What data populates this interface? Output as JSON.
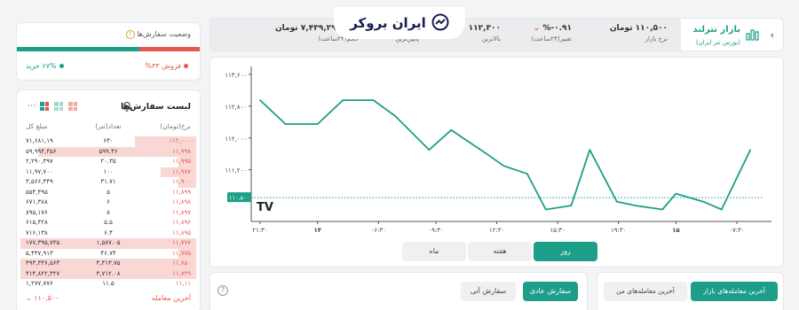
{
  "status": {
    "title": "وضعیت سفارش‌ها",
    "info_icon": "info-circle-icon",
    "sell_label": "فروش ۳۳%",
    "buy_label": "۶۷% خرید",
    "sell_percent": 33,
    "buy_percent": 67
  },
  "orders": {
    "title": "لیست سفارش‌ها",
    "bell_icon": "bell-plus-icon",
    "columns": [
      "نرخ(تومان)",
      "تعداد(تتر)",
      "مبلغ کل"
    ],
    "rows": [
      {
        "price": "۱۱۲,۰۰۰",
        "qty": "۶۴۰",
        "amount": "۷۱,۶۸۱,۱۹",
        "fill": 0.35
      },
      {
        "price": "۱۱,۹۹۸",
        "qty": "۵۹۹.۴۶",
        "amount": "۵۹,۹۹۴,۴۵۶",
        "fill": 0.9
      },
      {
        "price": "۱۱,۹۹۵",
        "qty": "۲۰.۳۵",
        "amount": "۲,۲۹۰,۴۹۷",
        "fill": 0.1
      },
      {
        "price": "۱۱,۹۷۷",
        "qty": "۱۰۰",
        "amount": "۱۱,۹۷,۷۰۰",
        "fill": 0.2
      },
      {
        "price": "۱۱,۹۰۰",
        "qty": "۳۱.۷۱",
        "amount": "۳,۵۶۶,۳۴۹",
        "fill": 0.1
      },
      {
        "price": "۱۱,۸۹۹",
        "qty": "۵",
        "amount": "۵۵۴,۴۹۵",
        "fill": 0
      },
      {
        "price": "۱۱,۸۹۸",
        "qty": "۶",
        "amount": "۶۷۱,۳۸۸",
        "fill": 0
      },
      {
        "price": "۱۱,۸۹۷",
        "qty": "۸",
        "amount": "۸۹۵,۱۷۶",
        "fill": 0
      },
      {
        "price": "۱۱,۸۹۶",
        "qty": "۵.۵",
        "amount": "۶۱۵,۴۲۸",
        "fill": 0
      },
      {
        "price": "۱۱,۸۹۵",
        "qty": "۶.۴",
        "amount": "۷۱۶,۱۳۸",
        "fill": 0
      },
      {
        "price": "۱۱,۷۷۷",
        "qty": "۱,۵۸۷.۰۵",
        "amount": "۱۷۷,۳۹۵,۷۳۵",
        "fill": 1
      },
      {
        "price": "۱۱,۷۷۵",
        "qty": "۴۶.۷۴",
        "amount": "۵,۴۴۷,۹۱۳",
        "fill": 0.1
      },
      {
        "price": "۱۱,۷۵۰",
        "qty": "۴,۴۱۳.۷۵",
        "amount": "۴۹۳,۳۳۶,۵۶۳",
        "fill": 1
      },
      {
        "price": "۱۱,۷۴۹",
        "qty": "۳,۷۱۲.۰۸",
        "amount": "۴۱۴,۸۲۲,۳۲۷",
        "fill": 1
      },
      {
        "price": "۱۱,۱۱",
        "qty": "۱۱.۵",
        "amount": "۱,۲۷۷,۷۷۶",
        "fill": 0
      }
    ],
    "last_trade_label": "آخرین معامله",
    "last_trade_price": "۱۱۰,۵۰۰"
  },
  "header": {
    "title": "بازار تترلند",
    "subtitle": "(بورس تتر ایران)",
    "stats": [
      {
        "value": "۱۱۰,۵۰۰ تومان",
        "label": "نرخ بازار"
      },
      {
        "value": "۰.۹۱-%",
        "label": "تغییر(۲۴ساعت)"
      },
      {
        "value": "۱۱۲,۳۰۰",
        "label": "بالاترین"
      },
      {
        "value": "۷,۴۳۹,۲۹۰,۶۱۹ تومان",
        "label": "حجم(۲۴ساعت)"
      }
    ],
    "partial_value": "هر",
    "partial_label_1": "پایین‌ترین",
    "partial_label_2": "تغییر(۲۴ساعت)"
  },
  "logo": {
    "text": "ایران بروکر",
    "icon": "swap-chart-icon"
  },
  "chart_data": {
    "type": "line",
    "y_ticks": [
      "۱۱۳,۶۰۰",
      "۱۱۲,۸۰۰",
      "۱۱۲,۰۰۰",
      "۱۱۱,۲۰۰"
    ],
    "y_tick_values": [
      113600,
      112800,
      112000,
      111200
    ],
    "x_ticks": [
      "۲۱:۳۰",
      "۱۴",
      "۰۶:۳۰",
      "۰۹:۳۰",
      "۱۲:۳۰",
      "۱۵:۳۰",
      "۱۹:۳۰",
      "۱۵",
      "۰۷:۳۰"
    ],
    "x_tick_positions": [
      0,
      1.7,
      3.5,
      5.2,
      7,
      8.8,
      10.6,
      12.3,
      14.1
    ],
    "x": [
      0,
      0.75,
      1.7,
      2.45,
      3.35,
      4.0,
      5.0,
      5.65,
      6.7,
      7.2,
      7.9,
      8.45,
      9.2,
      9.75,
      10.55,
      11.1,
      11.9,
      12.3,
      13.1,
      13.65,
      14.5
    ],
    "y": [
      112950,
      112350,
      112350,
      112950,
      112950,
      112550,
      111700,
      112200,
      111600,
      111300,
      111100,
      110200,
      110300,
      111700,
      110400,
      110300,
      110200,
      110600,
      110400,
      110200,
      111700,
      110500
    ],
    "last_price_label": "۱۱۰,۵۰۰",
    "last_price": 110500,
    "ylim": [
      109900,
      113800
    ],
    "watermark": "TV",
    "line_color": "#1d9e88"
  },
  "range_tabs": [
    {
      "label": "روز",
      "active": true
    },
    {
      "label": "هفته",
      "active": false
    },
    {
      "label": "ماه",
      "active": false
    }
  ],
  "order_panel": {
    "help_icon": "question-circle-icon",
    "normal_order": "سفارش عادی",
    "instant_order": "سفارش آنی"
  },
  "trades_panel": {
    "market_trades": "آخرین معامله‌های بازار",
    "my_trades": "آخرین معامله‌های من"
  },
  "colors": {
    "accent": "#1d9e88",
    "sell": "#e5574f",
    "brand": "#1a1d4e"
  }
}
